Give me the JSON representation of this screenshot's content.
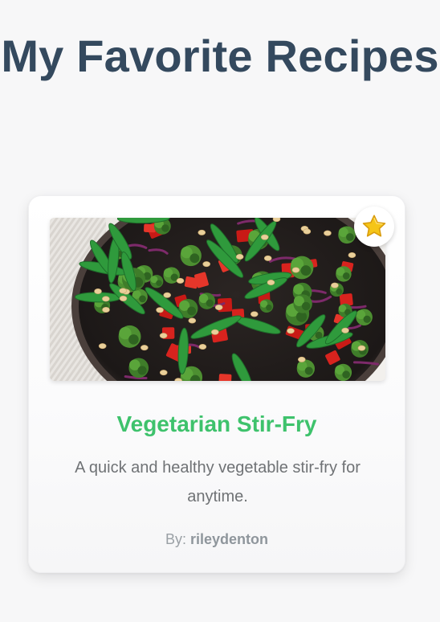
{
  "page": {
    "title": "My Favorite Recipes"
  },
  "recipe": {
    "title": "Vegetarian Stir-Fry",
    "description": "A quick and healthy vegetable stir-fry for anytime.",
    "author_prefix": "By:",
    "author": "rileydenton",
    "is_favorite": true,
    "favorite_icon": "star-icon",
    "image_icon": "stir-fry-photo"
  },
  "colors": {
    "title": "#34495e",
    "recipe_title": "#3ec26c",
    "description": "#6f7275",
    "author": "#9aa0a5",
    "background": "#f7f7f8",
    "star": "#f5c518"
  }
}
